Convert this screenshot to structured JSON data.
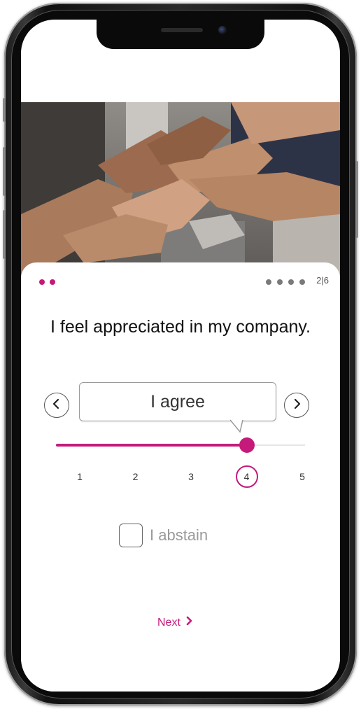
{
  "colors": {
    "accent": "#c51a7a",
    "inactive_dot": "#7a7a7a",
    "text": "#111111",
    "muted": "#9a9a9a"
  },
  "hero_image": {
    "icon": "team-hands-photo"
  },
  "progress": {
    "completed_dots": 2,
    "remaining_dots": 4,
    "counter": "2|6"
  },
  "question": {
    "text": "I feel appreciated in my company."
  },
  "answer": {
    "value_label": "I agree",
    "prev_icon": "chevron-left-icon",
    "next_icon": "chevron-right-icon"
  },
  "slider": {
    "min": 1,
    "max": 5,
    "value": 4,
    "scale": [
      "1",
      "2",
      "3",
      "4",
      "5"
    ]
  },
  "abstain": {
    "label": "I abstain",
    "checked": false
  },
  "navigation": {
    "next_label": "Next",
    "next_icon": "chevron-right-icon"
  }
}
